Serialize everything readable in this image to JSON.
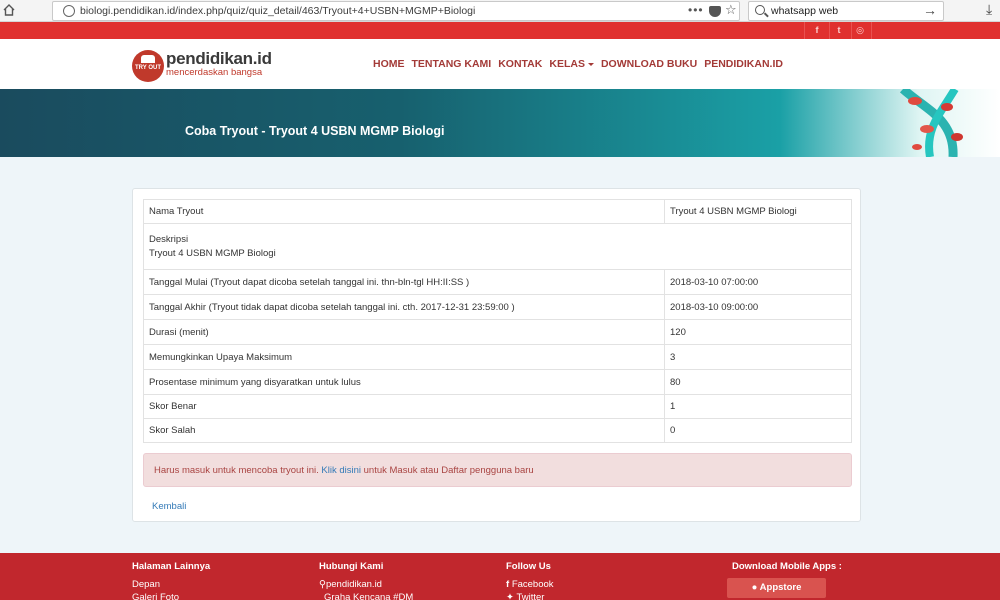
{
  "browser": {
    "url": "biologi.pendidikan.id/index.php/quiz/quiz_detail/463/Tryout+4+USBN+MGMP+Biologi",
    "more_label": "•••",
    "search_value": "whatsapp web"
  },
  "social_top": [
    {
      "glyph": "f",
      "icon": "facebook-icon"
    },
    {
      "glyph": "t",
      "icon": "twitter-icon"
    },
    {
      "glyph": "◎",
      "icon": "instagram-icon"
    }
  ],
  "logo": {
    "name": "pendidikan.id",
    "tagline": "mencerdaskan bangsa",
    "mark_text": "TRY OUT"
  },
  "nav": [
    {
      "label": "HOME"
    },
    {
      "label": "TENTANG KAMI"
    },
    {
      "label": "KONTAK"
    },
    {
      "label": "KELAS",
      "dropdown": true
    },
    {
      "label": "DOWNLOAD BUKU"
    },
    {
      "label": "PENDIDIKAN.ID"
    }
  ],
  "banner": {
    "title": "Coba Tryout - Tryout 4 USBN MGMP Biologi"
  },
  "details": {
    "nama_label": "Nama Tryout",
    "nama_value": "Tryout 4 USBN MGMP Biologi",
    "deskripsi_label": "Deskripsi",
    "deskripsi_value": "Tryout 4 USBN MGMP Biologi",
    "rows": [
      {
        "label": "Tanggal Mulai (Tryout dapat dicoba setelah tanggal ini. thn-bln-tgl HH:II:SS )",
        "value": "2018-03-10 07:00:00"
      },
      {
        "label": "Tanggal Akhir (Tryout tidak dapat dicoba setelah tanggal ini. cth. 2017-12-31 23:59:00 )",
        "value": "2018-03-10 09:00:00"
      },
      {
        "label": "Durasi (menit)",
        "value": "120"
      },
      {
        "label": "Memungkinkan Upaya Maksimum",
        "value": "3"
      },
      {
        "label": "Prosentase minimum yang disyaratkan untuk lulus",
        "value": "80"
      },
      {
        "label": "Skor Benar",
        "value": "1"
      },
      {
        "label": "Skor Salah",
        "value": "0"
      }
    ]
  },
  "alert": {
    "prefix": "Harus masuk untuk mencoba tryout ini. ",
    "link": "Klik disini",
    "suffix": " untuk Masuk atau Daftar pengguna baru"
  },
  "back_label": "Kembali",
  "footer": {
    "col1": {
      "heading": "Halaman Lainnya",
      "items": [
        "Depan",
        "Galeri Foto"
      ]
    },
    "col2": {
      "heading": "Hubungi Kami",
      "items": [
        "pendidikan.id",
        "Graha Kencana #DM"
      ]
    },
    "col3": {
      "heading": "Follow Us",
      "items": [
        "Facebook",
        "Twitter"
      ]
    },
    "col4": {
      "heading": "Download Mobile Apps :",
      "button": "Appstore"
    }
  },
  "colors": {
    "brand_red": "#e0312f",
    "nav_text": "#a33a37",
    "footer_red": "#c1272d",
    "banner_teal": "#17606e",
    "link_blue": "#337ab7",
    "alert_bg": "#f2dede"
  }
}
